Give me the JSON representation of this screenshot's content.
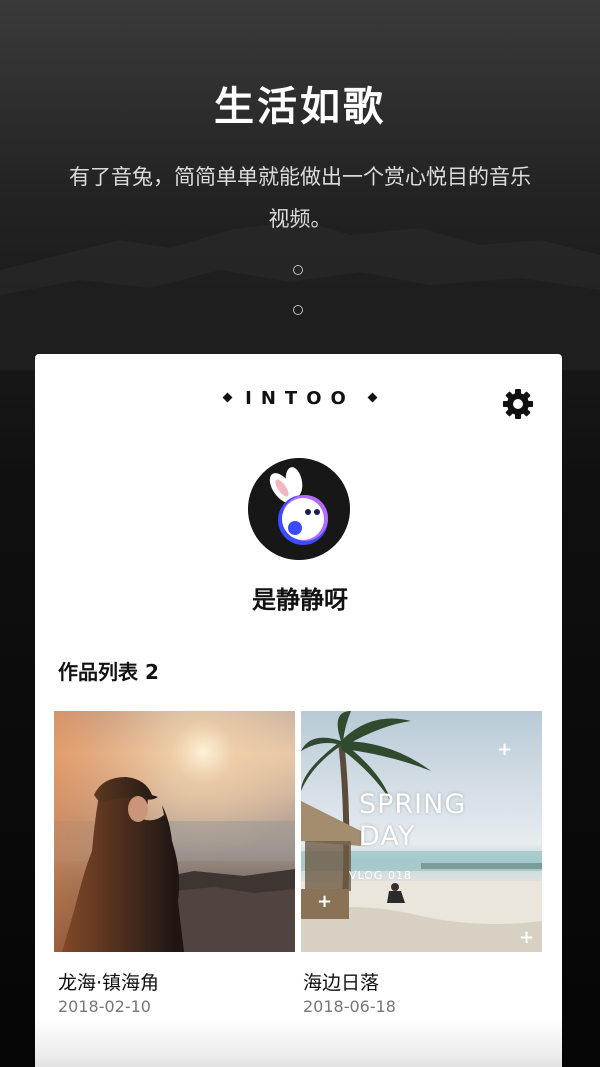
{
  "hero": {
    "headline": "生活如歌",
    "subtitle": "有了音兔，简简单单就能做出一个赏心悦目的音乐视频。"
  },
  "app": {
    "brand": "INTOO",
    "settings_icon": "gear-icon"
  },
  "profile": {
    "username": "是静静呀",
    "avatar_icon": "rabbit-logo-icon"
  },
  "works": {
    "title": "作品列表 2",
    "items": [
      {
        "title": "龙海·镇海角",
        "date": "2018-02-10"
      },
      {
        "title": "海边日落",
        "date": "2018-06-18",
        "overlay_title": "SPRING DAY",
        "overlay_subtitle": "VLOG 018"
      }
    ]
  },
  "colors": {
    "accent_purple": "#b36bff",
    "accent_blue": "#3b4bff",
    "card_bg": "#ffffff"
  }
}
